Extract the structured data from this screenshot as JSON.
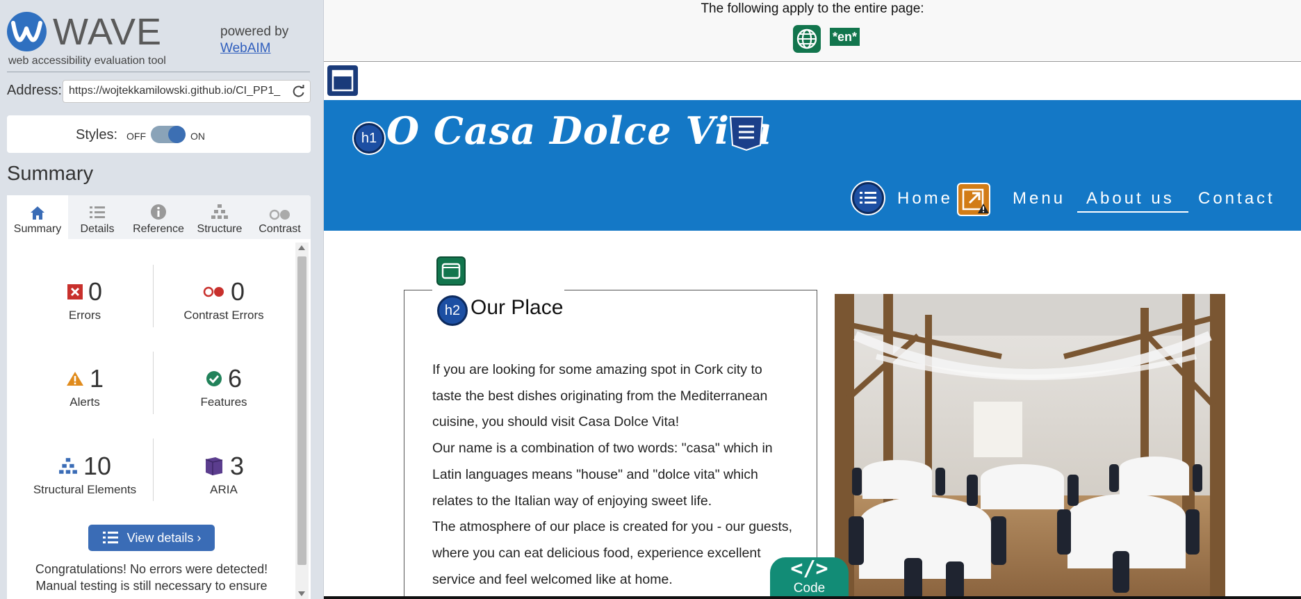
{
  "sidebar": {
    "brand_name": "WAVE",
    "brand_tagline": "web accessibility evaluation tool",
    "powered_by": "powered by",
    "powered_link": "WebAIM",
    "address_label": "Address:",
    "address_value": "https://wojtekkamilowski.github.io/CI_PP1_",
    "styles_label": "Styles:",
    "styles_off": "OFF",
    "styles_on": "ON",
    "styles_state": "on",
    "summary_title": "Summary",
    "tabs": [
      {
        "label": "Summary",
        "icon": "home-icon",
        "active": true
      },
      {
        "label": "Details",
        "icon": "list-icon",
        "active": false
      },
      {
        "label": "Reference",
        "icon": "info-icon",
        "active": false
      },
      {
        "label": "Structure",
        "icon": "structure-icon",
        "active": false
      },
      {
        "label": "Contrast",
        "icon": "contrast-icon",
        "active": false
      }
    ],
    "stats": [
      {
        "label": "Errors",
        "value": "0",
        "icon": "error-icon",
        "color": "#c8302c"
      },
      {
        "label": "Contrast Errors",
        "value": "0",
        "icon": "contrast-error-icon",
        "color": "#c8302c"
      },
      {
        "label": "Alerts",
        "value": "1",
        "icon": "alert-icon",
        "color": "#e08b1c"
      },
      {
        "label": "Features",
        "value": "6",
        "icon": "feature-icon",
        "color": "#21825a"
      },
      {
        "label": "Structural Elements",
        "value": "10",
        "icon": "structure-icon",
        "color": "#3a6cb6"
      },
      {
        "label": "ARIA",
        "value": "3",
        "icon": "aria-icon",
        "color": "#5b3d8e"
      }
    ],
    "view_details": "View details ›",
    "congrats_1": "Congratulations! No errors were detected!",
    "congrats_2": "Manual testing is still necessary to ensure"
  },
  "page": {
    "top_note": "The following apply to the entire page:",
    "lang_badge": "*en*",
    "site_title": "O Casa Dolce Vita",
    "h1_badge": "h1",
    "h2_badge": "h2",
    "nav": [
      "Home",
      "Menu",
      "About us",
      "Contact"
    ],
    "active_nav": "About us",
    "section_heading": "Our Place",
    "paragraphs": [
      "If you are looking for some amazing spot in Cork city to taste the best dishes originating from the Mediterranean cuisine, you should visit Casa Dolce Vita!",
      "Our name is a combination of two words: \"casa\" which in Latin languages means \"house\" and \"dolce vita\" which relates to the Italian way of enjoying sweet life.",
      "The atmosphere of our place is created for you - our guests, where you can eat delicious food, experience excellent service and feel welcomed like at home."
    ],
    "code_glyph": "</>",
    "code_label": "Code"
  },
  "colors": {
    "header_blue": "#1478c6",
    "wave_blue": "#3a6cb6",
    "feature_green": "#12754d",
    "code_teal": "#128c76"
  }
}
